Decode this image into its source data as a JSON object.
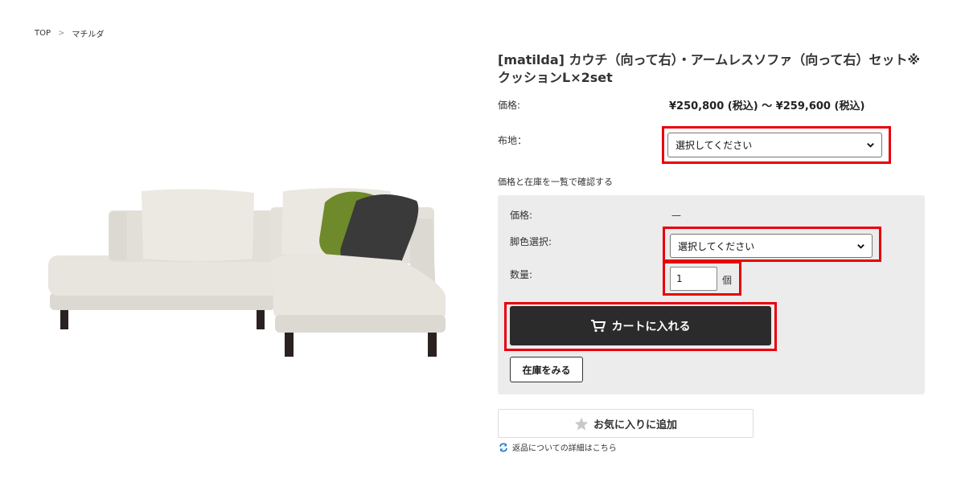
{
  "breadcrumb": {
    "home": "TOP",
    "separator": ">",
    "current": "マチルダ"
  },
  "product": {
    "title": "[matilda] カウチ（向って右）・アームレスソファ（向って右）セット※クッションL×2set",
    "price_label": "価格:",
    "price_value": "¥250,800 (税込) ～ ¥259,600 (税込)"
  },
  "fabric": {
    "label": "布地：",
    "selected": "選択してください"
  },
  "inventory_link": "価格と在庫を一覧で確認する",
  "panel": {
    "price_label": "価格:",
    "price_value": "—",
    "leg_color_label": "脚色選択:",
    "leg_color_selected": "選択してください",
    "quantity_label": "数量:",
    "quantity_value": "1",
    "quantity_unit": "個",
    "cart_button": "カートに入れる",
    "stock_button": "在庫をみる"
  },
  "favorite_button": "お気に入りに追加",
  "returns_link": "返品についての詳細はこちら",
  "colors": {
    "highlight": "#e8000b",
    "cart_button_bg": "#2b2b2b",
    "panel_bg": "#ececec",
    "sofa_fabric": "#e6e2dc",
    "cushion_green": "#6f8a2a",
    "cushion_dark": "#3a3a3a"
  },
  "icons": [
    "chevron-right-icon",
    "chevron-down-icon",
    "cart-icon",
    "star-icon",
    "refresh-icon"
  ]
}
